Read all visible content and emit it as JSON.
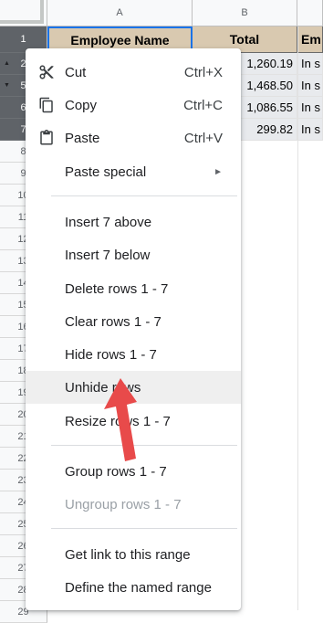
{
  "columns": [
    "A",
    "B"
  ],
  "row_numbers": [
    "1",
    "2",
    "5",
    "6",
    "7",
    "8",
    "9",
    "10",
    "11",
    "12",
    "13",
    "14",
    "15",
    "16",
    "17",
    "18",
    "19",
    "20",
    "21",
    "22",
    "23",
    "24",
    "25",
    "26",
    "27",
    "28",
    "29"
  ],
  "cells": {
    "a1": "Employee Name",
    "b1": "Total",
    "c1": "Em",
    "totals": [
      "1,260.19",
      "1,468.50",
      "1,086.55",
      "299.82"
    ],
    "status": [
      "In s",
      "In s",
      "In s",
      "In s"
    ]
  },
  "context_menu": {
    "cut": {
      "label": "Cut",
      "shortcut": "Ctrl+X",
      "icon": "scissors-icon"
    },
    "copy": {
      "label": "Copy",
      "shortcut": "Ctrl+C",
      "icon": "copy-icon"
    },
    "paste": {
      "label": "Paste",
      "shortcut": "Ctrl+V",
      "icon": "clipboard-icon"
    },
    "paste_special": {
      "label": "Paste special"
    },
    "insert_above": "Insert 7 above",
    "insert_below": "Insert 7 below",
    "delete_rows": "Delete rows 1 - 7",
    "clear_rows": "Clear rows 1 - 7",
    "hide_rows": "Hide rows 1 - 7",
    "unhide_rows": "Unhide rows",
    "resize_rows": "Resize rows 1 - 7",
    "group_rows": "Group rows 1 - 7",
    "ungroup_rows": "Ungroup rows 1 - 7",
    "get_link": "Get link to this range",
    "define_named_range": "Define the named range"
  },
  "colors": {
    "header_fill": "#d9c9b0",
    "selected_row_header": "#5f6368",
    "pointer_arrow": "#e84a4a"
  }
}
